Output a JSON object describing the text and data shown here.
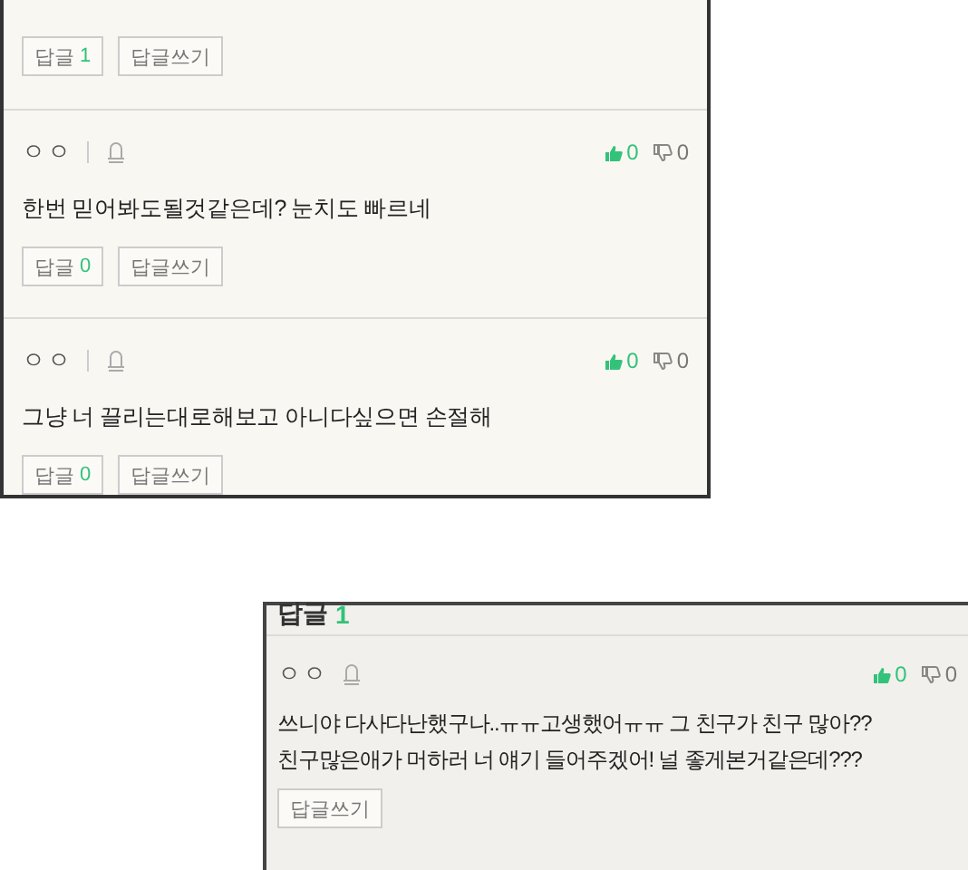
{
  "comment_list": {
    "items": [
      {
        "reply_label": "답글",
        "reply_count": "1",
        "write_label": "답글쓰기"
      },
      {
        "author": "ㅇㅇ",
        "author_divider": true,
        "likes": "0",
        "dislikes": "0",
        "text": "한번 믿어봐도될것같은데? 눈치도 빠르네",
        "reply_label": "답글",
        "reply_count": "0",
        "write_label": "답글쓰기"
      },
      {
        "author": "ㅇㅇ",
        "author_divider": true,
        "likes": "0",
        "dislikes": "0",
        "text": "그냥 너 끌리는대로해보고 아니다싶으면 손절해",
        "reply_label": "답글",
        "reply_count": "0",
        "write_label": "답글쓰기"
      }
    ]
  },
  "reply_panel": {
    "title": "답글",
    "count": "1",
    "items": [
      {
        "author": "ㅇㅇ",
        "author_divider": false,
        "likes": "0",
        "dislikes": "0",
        "text_lines": [
          "쓰니야 다사다난했구나..ㅠㅠ고생했어ㅠㅠ 그 친구가 친구 많아??",
          "친구많은애가 머하러 너 얘기 들어주겠어! 널 좋게본거같은데???"
        ],
        "write_label": "답글쓰기"
      }
    ]
  }
}
